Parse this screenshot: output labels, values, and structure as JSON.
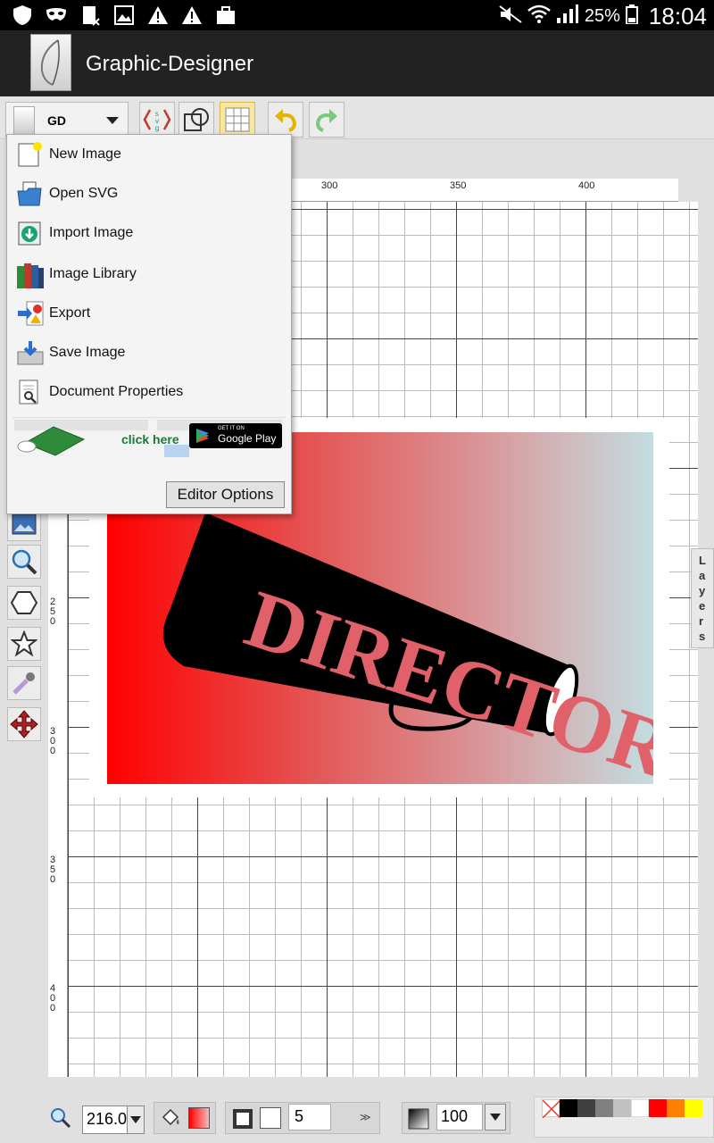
{
  "status_bar": {
    "battery_percent": "25%",
    "time": "18:04"
  },
  "app": {
    "title": "Graphic-Designer"
  },
  "toolbar": {
    "dropdown_label": "GD",
    "buttons": [
      "svg-source",
      "shapes",
      "grid-toggle",
      "undo",
      "redo"
    ]
  },
  "menu": {
    "items": [
      {
        "label": "New Image",
        "icon": "new-image-icon"
      },
      {
        "label": "Open SVG",
        "icon": "folder-open-icon"
      },
      {
        "label": "Import Image",
        "icon": "import-icon"
      },
      {
        "label": "Image Library",
        "icon": "books-icon"
      },
      {
        "label": "Export",
        "icon": "export-icon"
      },
      {
        "label": "Save Image",
        "icon": "save-icon"
      },
      {
        "label": "Document Properties",
        "icon": "document-properties-icon"
      }
    ],
    "ad": {
      "click_text": "click here",
      "store_small": "GET IT ON",
      "store_big": "Google Play"
    },
    "editor_options_label": "Editor Options"
  },
  "rulers": {
    "top": [
      "300",
      "350",
      "400"
    ],
    "left": [
      "250",
      "300",
      "350",
      "400"
    ]
  },
  "artwork": {
    "text": "DIRECTOR"
  },
  "layers_tab": {
    "label": "Layers"
  },
  "bottom_bar": {
    "zoom": "216.0",
    "stroke_width": "5",
    "opacity": "100"
  },
  "palette": {
    "colors": [
      "#000000",
      "#404040",
      "#808080",
      "#c0c0c0",
      "#ffffff",
      "#ff0000",
      "#ff8000",
      "#ffff00"
    ]
  }
}
